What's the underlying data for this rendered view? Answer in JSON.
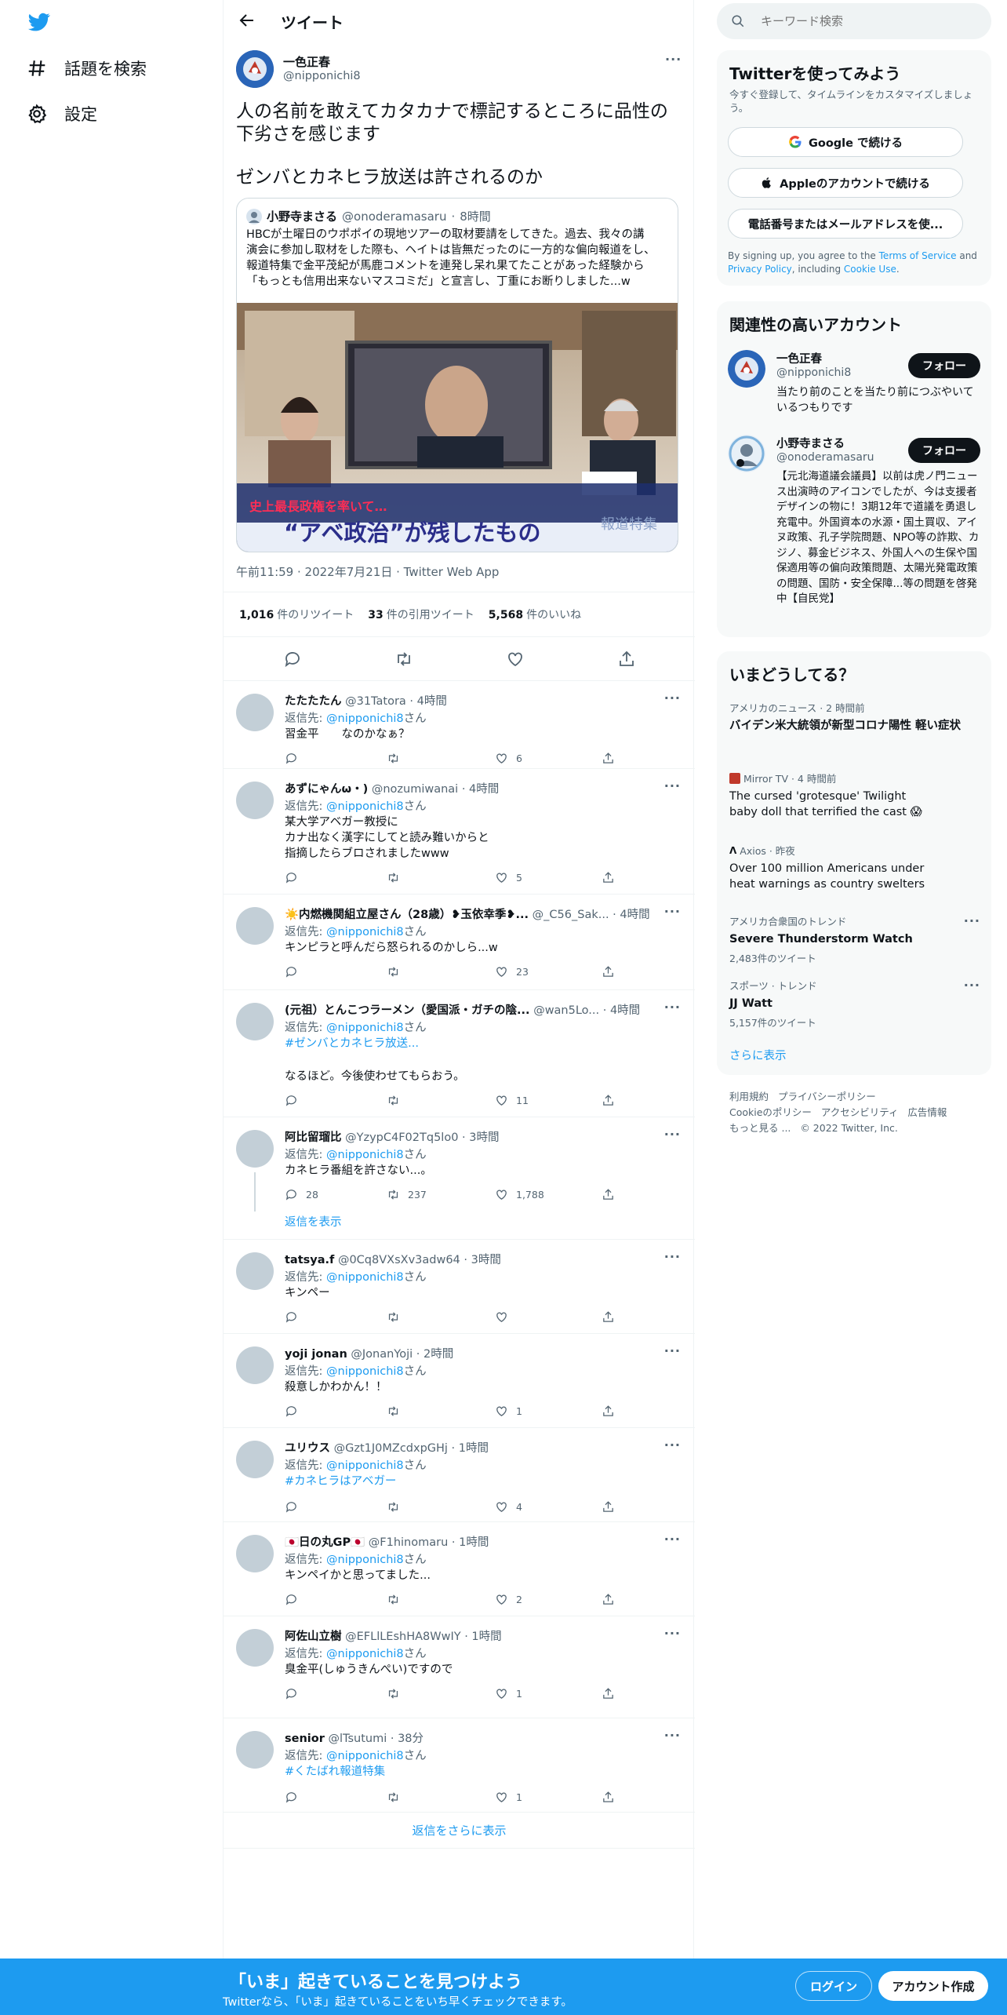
{
  "nav": {
    "explore": "話題を検索",
    "settings": "設定"
  },
  "header": {
    "title": "ツイート"
  },
  "tweet": {
    "name": "一色正春",
    "handle": "@nipponichi8",
    "text1": "人の名前を敢えてカタカナで標記するところに品性の下劣さを感じます",
    "text2": "ゼンバとカネヒラ放送は許されるのか",
    "quote": {
      "name": "小野寺まさる",
      "handle": "@onoderamasaru",
      "time": "8時間",
      "lines": [
        "HBCが土曜日のウポポイの現地ツアーの取材要請をしてきた。過去、我々の講",
        "演会に参加し取材をした際も、ヘイトは皆無だったのに一方的な偏向報道をし、",
        "報道特集で金平茂紀が馬鹿コメントを連発し呆れ果てたことがあった経験から",
        "「もっとも信用出来ないマスコミだ」と宣言し、丁重にお断りしました...w"
      ],
      "image": {
        "caption_small": "史上最長政権を率いて…",
        "caption_big": "“アベ政治”が残したもの",
        "logo": "報道特集"
      }
    },
    "timestamp": "午前11:59 · 2022年7月21日 · Twitter Web App",
    "retweets": "1,016",
    "retweets_label": "件のリツイート",
    "quotes": "33",
    "quotes_label": "件の引用ツイート",
    "likes": "5,568",
    "likes_label": "件のいいね"
  },
  "replies": [
    {
      "name": "たたたたん",
      "handle": "@31Tatora",
      "time": "4時間",
      "to": "返信先: ",
      "to_handle": "@nipponichi8",
      "to_suffix": "さん",
      "lines": [
        "習金平　　なのかなぁ？"
      ],
      "likes": "6"
    },
    {
      "name": "あずにゃんω・)",
      "handle": "@nozumiwanai",
      "time": "4時間",
      "to": "返信先: ",
      "to_handle": "@nipponichi8",
      "to_suffix": "さん",
      "lines": [
        "某大学アベガー教授に",
        "カナ出なく漢字にしてと読み難いからと",
        "指摘したらブロされましたwww"
      ],
      "likes": "5"
    },
    {
      "name": "☀️内燃機関組立屋さん（28歳）❥玉依幸季❥...",
      "handle": "@_C56_Sak...",
      "time": "4時間",
      "to": "返信先: ",
      "to_handle": "@nipponichi8",
      "to_suffix": "さん",
      "lines": [
        "キンピラと呼んだら怒られるのかしら...w"
      ],
      "likes": "23"
    },
    {
      "name": "(元祖）とんこつラーメン（愛国派・ガチの陰...",
      "handle": "@wan5Lo...",
      "time": "4時間",
      "to": "返信先: ",
      "to_handle": "@nipponichi8",
      "to_suffix": "さん",
      "hashtag": "#ゼンバとカネヒラ放送...",
      "lines": [
        "なるほど。今後使わせてもらおう。"
      ],
      "likes": "11"
    },
    {
      "name": "阿比留瑠比",
      "handle": "@YzypC4F02Tq5lo0",
      "time": "3時間",
      "to": "返信先: ",
      "to_handle": "@nipponichi8",
      "to_suffix": "さん",
      "lines": [
        "カネヒラ番組を許さない...。"
      ],
      "replies": "28",
      "rts": "237",
      "likes": "1,788",
      "show_thread": "返信を表示"
    },
    {
      "name": "tatsya.f",
      "handle": "@0Cq8VXsXv3adw64",
      "time": "3時間",
      "to": "返信先: ",
      "to_handle": "@nipponichi8",
      "to_suffix": "さん",
      "lines": [
        "キンペー"
      ],
      "likes": ""
    },
    {
      "name": "yoji jonan",
      "handle": "@JonanYoji",
      "time": "2時間",
      "to": "返信先: ",
      "to_handle": "@nipponichi8",
      "to_suffix": "さん",
      "lines": [
        "殺意しかわかん！！"
      ],
      "likes": "1"
    },
    {
      "name": "ユリウス",
      "handle": "@Gzt1J0MZcdxpGHj",
      "time": "1時間",
      "to": "返信先: ",
      "to_handle": "@nipponichi8",
      "to_suffix": "さん",
      "hashtag": "#カネヒラはアベガー",
      "lines": [],
      "likes": "4"
    },
    {
      "name": "🇯🇵日の丸GP🇯🇵",
      "handle": "@F1hinomaru",
      "time": "1時間",
      "to": "返信先: ",
      "to_handle": "@nipponichi8",
      "to_suffix": "さん",
      "lines": [
        "キンペイかと思ってました..."
      ],
      "likes": "2"
    },
    {
      "name": "阿佐山立樹",
      "handle": "@EFLlLEshHA8WwIY",
      "time": "1時間",
      "to": "返信先: ",
      "to_handle": "@nipponichi8",
      "to_suffix": "さん",
      "lines": [
        "臭金平(しゅうきんぺい)ですので"
      ],
      "likes": "1"
    },
    {
      "name": "senior",
      "handle": "@lTsutumi",
      "time": "38分",
      "to": "返信先: ",
      "to_handle": "@nipponichi8",
      "to_suffix": "さん",
      "hashtag": "#くたばれ報道特集",
      "lines": [],
      "likes": "1"
    }
  ],
  "show_more_replies": "返信をさらに表示",
  "search": {
    "placeholder": "キーワード検索"
  },
  "signup_card": {
    "title": "Twitterを使ってみよう",
    "sub": "今すぐ登録して、タイムラインをカスタマイズしましょう。",
    "google": "Google で続ける",
    "apple": "Appleのアカウントで続ける",
    "phone": "電話番号またはメールアドレスを使...",
    "legal1": "By signing up, you agree to the ",
    "tos": "Terms of Service",
    "legal2": " and ",
    "privacy": "Privacy Policy",
    "legal3": ", including ",
    "cookie": "Cookie Use",
    "legal4": "."
  },
  "relevant": {
    "title": "関連性の高いアカウント",
    "follow_label": "フォロー",
    "accounts": [
      {
        "name": "一色正春",
        "handle": "@nipponichi8",
        "bio": "当たり前のことを当たり前につぶやいているつもりです"
      },
      {
        "name": "小野寺まさる",
        "handle": "@onoderamasaru",
        "bio": "【元北海道議会議員】以前は虎ノ門ニュース出演時のアイコンでしたが、今は支援者デザインの物に！3期12年で道議を勇退し充電中。外国資本の水源・国土買収、アイヌ政策、孔子学院問題、NPO等の詐欺、カジノ、募金ビジネス、外国人への生保や国保適用等の偏向政策問題、太陽光発電政策の問題、国防・安全保障...等の問題を啓発中【自民党】"
      }
    ]
  },
  "trends": {
    "title": "いまどうしてる？",
    "items": [
      {
        "sub": "アメリカのニュース · 2 時間前",
        "name": "バイデン米大統領が新型コロナ陽性 軽い症状",
        "count": ""
      },
      {
        "sub": "Mirror TV · 4 時間前",
        "name": "The cursed 'grotesque' Twilight baby doll that terrified the cast 😱",
        "count": ""
      },
      {
        "sub": "Axios · 昨夜",
        "name": "Over 100 million Americans under heat warnings as country swelters",
        "count": ""
      },
      {
        "sub": "アメリカ合衆国のトレンド",
        "name": "Severe Thunderstorm Watch",
        "count": "2,483件のツイート"
      },
      {
        "sub": "スポーツ · トレンド",
        "name": "JJ Watt",
        "count": "5,157件のツイート"
      }
    ],
    "show_more": "さらに表示"
  },
  "footer": {
    "terms": "利用規約",
    "privacy": "プライバシーポリシー",
    "cookie": "Cookieのポリシー",
    "access": "アクセシビリティ",
    "ads": "広告情報",
    "more": "もっと見る ...",
    "copy": "© 2022 Twitter, Inc."
  },
  "banner": {
    "title": "「いま」起きていることを見つけよう",
    "sub": "Twitterなら、「いま」起きていることをいち早くチェックできます。",
    "login": "ログイン",
    "signup": "アカウント作成"
  },
  "colors": {
    "accent": "#1d9bf0",
    "text": "#0f1419",
    "muted": "#536471",
    "border": "#eff3f4"
  }
}
